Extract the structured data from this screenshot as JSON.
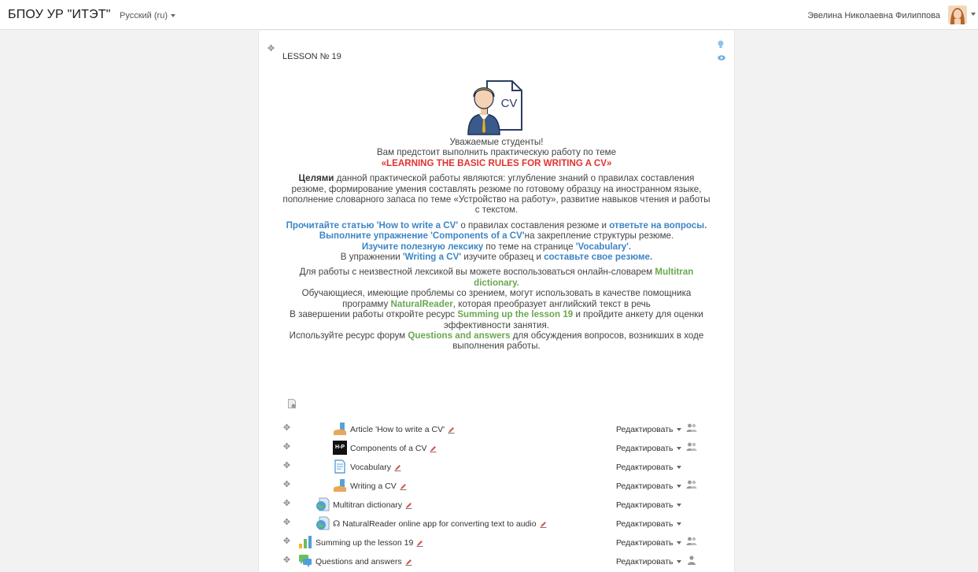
{
  "navbar": {
    "site_name": "БПОУ УР \"ИТЭТ\"",
    "language": "Русский (ru)",
    "user_name": "Эвелина Николаевна Филиппова"
  },
  "section": {
    "title": "LESSON № 19",
    "icon_label": "CV",
    "greeting": "Уважаемые студенты!",
    "intro": "Вам предстоит выполнить практическую работу по теме",
    "topic": "«LEARNING THE BASIC RULES FOR WRITING A CV»",
    "goals_bold": "Целями",
    "goals_text": " данной практической работы являются: углубление знаний о правилах составления резюме, формирование умения составлять резюме по готовому образцу на иностранном языке, пополнение словарного запаса по теме «Устройство на работу», развитие навыков чтения и работы с текстом.",
    "task1_link": "Прочитайте статью 'How to write a CV'",
    "task1_text": " о правилах составления резюме и ",
    "task1_link2": "ответьте на вопросы.",
    "task2_link": "Выполните упражнение 'Components of a CV'",
    "task2_text": "на закрепление структуры резюме.",
    "task3_link": "Изучите полезную лексику",
    "task3_text": " по теме на странице ",
    "task3_link2": "'Vocabulary'.",
    "task4_text1": "В упражнении ",
    "task4_link": "'Writing a CV'",
    "task4_text2": " изучите образец  и ",
    "task4_link2": "составьте свое резюме.",
    "dict_text": "Для работы с неизвестной лексикой вы можете воспользоваться онлайн-словарем ",
    "dict_link": "Multitran dictionary.",
    "vision_text1": "Обучающиеся, имеющие проблемы со зрением, могут использовать в качестве помощника программу ",
    "vision_link": "NaturalReader",
    "vision_text2": ", которая преобразует английский текст в речь",
    "finish_text1": "В завершении работы откройте ресурс ",
    "finish_link": "Summing up the lesson 19",
    "finish_text2": " и пройдите анкету для оценки эффективности занятия.",
    "forum_text1": "Используйте ресурс форум ",
    "forum_link": "Questions and answers",
    "forum_text2": " для обсуждения вопросов, возникших в ходе выполнения работы."
  },
  "activities": [
    {
      "name": "Article 'How to write a CV'",
      "edit": "Редактировать",
      "icon": "lesson-icon",
      "group": true
    },
    {
      "name": "Components of a CV",
      "edit": "Редактировать",
      "icon": "h5p-icon",
      "group": true
    },
    {
      "name": "Vocabulary",
      "edit": "Редактировать",
      "icon": "page-icon",
      "group": false
    },
    {
      "name": "Writing a CV",
      "edit": "Редактировать",
      "icon": "lesson-icon",
      "group": true
    },
    {
      "name": "Multitran dictionary",
      "edit": "Редактировать",
      "icon": "url-icon",
      "group": false
    },
    {
      "name": "☊ NaturalReader online app for converting text to audio",
      "edit": "Редактировать",
      "icon": "url-icon",
      "group": false
    },
    {
      "name": "Summing up the lesson 19",
      "edit": "Редактировать",
      "icon": "feedback-icon",
      "group": true
    },
    {
      "name": "Questions and answers",
      "edit": "Редактировать",
      "icon": "forum-icon",
      "group": true
    }
  ],
  "h5p_badge": "H-P"
}
